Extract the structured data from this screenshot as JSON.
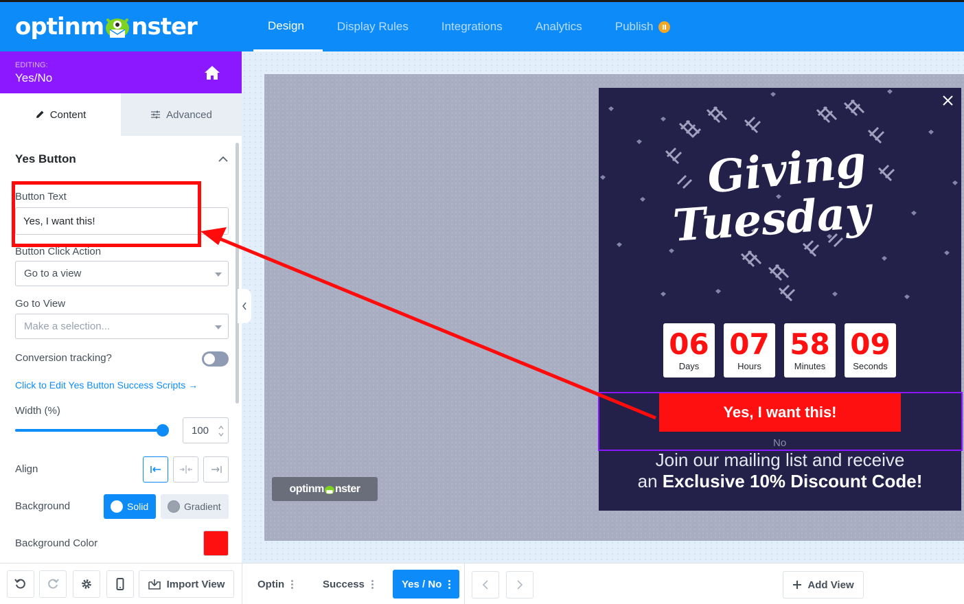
{
  "brand": {
    "logo_text_left": "optinm",
    "logo_text_right": "nster"
  },
  "nav": {
    "items": [
      {
        "label": "Design"
      },
      {
        "label": "Display Rules"
      },
      {
        "label": "Integrations"
      },
      {
        "label": "Analytics"
      },
      {
        "label": "Publish"
      }
    ]
  },
  "editing": {
    "label": "EDITING:",
    "title": "Yes/No"
  },
  "tabs": {
    "content": "Content",
    "advanced": "Advanced"
  },
  "panel": {
    "section_title": "Yes Button",
    "button_text_label": "Button Text",
    "button_text_value": "Yes, I want this!",
    "click_action_label": "Button Click Action",
    "click_action_value": "Go to a view",
    "go_to_view_label": "Go to View",
    "go_to_view_placeholder": "Make a selection...",
    "conversion_label": "Conversion tracking?",
    "success_scripts_link": "Click to Edit Yes Button Success Scripts →",
    "width_label": "Width (%)",
    "width_value": "100",
    "align_label": "Align",
    "background_label": "Background",
    "background_solid": "Solid",
    "background_gradient": "Gradient",
    "background_color_label": "Background Color",
    "background_color": "#ff1010"
  },
  "toolbar": {
    "import_view": "Import View"
  },
  "popup": {
    "hero_line1": "Giving",
    "hero_line2": "Tuesday",
    "countdown": [
      {
        "value": "06",
        "label": "Days"
      },
      {
        "value": "07",
        "label": "Hours"
      },
      {
        "value": "58",
        "label": "Minutes"
      },
      {
        "value": "09",
        "label": "Seconds"
      }
    ],
    "yes_button": "Yes, I want this!",
    "no_link": "No",
    "join_line1": "Join our mailing list and receive",
    "join_line2_prefix": "an",
    "join_line2_bold": "Exclusive 10% Discount Code!"
  },
  "badge": {
    "left": "optinm",
    "right": "nster"
  },
  "views": {
    "tabs": [
      {
        "label": "Optin"
      },
      {
        "label": "Success"
      },
      {
        "label": "Yes / No"
      }
    ],
    "add_view": "Add View"
  },
  "colors": {
    "brand_blue": "#0d8cf9",
    "editing_purple": "#8c18ff",
    "popup_navy": "#232049",
    "cta_red": "#ff1010"
  }
}
